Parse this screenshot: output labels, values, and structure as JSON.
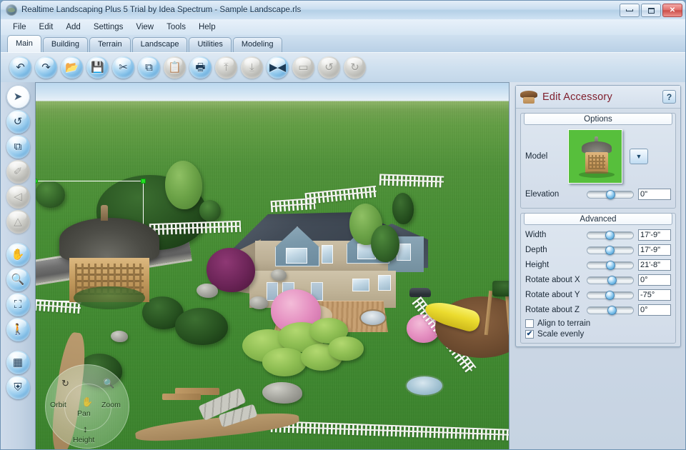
{
  "window": {
    "title": "Realtime Landscaping Plus 5 Trial by Idea Spectrum - Sample Landscape.rls",
    "app_icon": "app-globe-icon",
    "minimize_label": "Minimize",
    "maximize_label": "Maximize",
    "close_label": "✕"
  },
  "menubar": {
    "items": [
      {
        "label": "File"
      },
      {
        "label": "Edit"
      },
      {
        "label": "Add"
      },
      {
        "label": "Settings"
      },
      {
        "label": "View"
      },
      {
        "label": "Tools"
      },
      {
        "label": "Help"
      }
    ]
  },
  "tabs": {
    "active": "Main",
    "items": [
      {
        "label": "Main"
      },
      {
        "label": "Building"
      },
      {
        "label": "Terrain"
      },
      {
        "label": "Landscape"
      },
      {
        "label": "Utilities"
      },
      {
        "label": "Modeling"
      }
    ]
  },
  "toolbar": {
    "buttons": [
      {
        "name": "undo-icon",
        "glyph": "↶",
        "enabled": true
      },
      {
        "name": "redo-icon",
        "glyph": "↷",
        "enabled": true
      },
      {
        "name": "open-folder-icon",
        "glyph": "📂",
        "enabled": true
      },
      {
        "name": "save-icon",
        "glyph": "💾",
        "enabled": true
      },
      {
        "name": "cut-scissors-icon",
        "glyph": "✂",
        "enabled": true
      },
      {
        "name": "copy-icon",
        "glyph": "⧉",
        "enabled": true
      },
      {
        "name": "paste-icon",
        "glyph": "📋",
        "enabled": false
      },
      {
        "name": "print-icon",
        "glyph": "🖶",
        "enabled": true
      },
      {
        "name": "bring-to-front-icon",
        "glyph": "⤒",
        "enabled": false
      },
      {
        "name": "send-to-back-icon",
        "glyph": "⤓",
        "enabled": false
      },
      {
        "name": "mirror-icon",
        "glyph": "▶◀",
        "enabled": true
      },
      {
        "name": "flatten-icon",
        "glyph": "▭",
        "enabled": false
      },
      {
        "name": "rotate-left-icon",
        "glyph": "↺",
        "enabled": false
      },
      {
        "name": "rotate-right-icon",
        "glyph": "↻",
        "enabled": false
      }
    ]
  },
  "left_toolbar": {
    "buttons": [
      {
        "name": "select-arrow-tool",
        "glyph": "➤",
        "state": "active"
      },
      {
        "name": "rotate-tool",
        "glyph": "↺",
        "state": "normal"
      },
      {
        "name": "copy-place-tool",
        "glyph": "⧉",
        "state": "normal"
      },
      {
        "name": "freehand-region-tool",
        "glyph": "✐",
        "state": "disabled"
      },
      {
        "name": "polygon-region-tool",
        "glyph": "◁",
        "state": "disabled"
      },
      {
        "name": "shape-region-tool",
        "glyph": "△",
        "state": "disabled"
      },
      {
        "name": "pan-hand-tool",
        "glyph": "✋",
        "state": "normal"
      },
      {
        "name": "zoom-tool",
        "glyph": "🔍",
        "state": "normal"
      },
      {
        "name": "zoom-to-fit-tool",
        "glyph": "⛶",
        "state": "normal"
      },
      {
        "name": "walk-through-tool",
        "glyph": "🚶",
        "state": "normal"
      },
      {
        "name": "grid-tool",
        "glyph": "▦",
        "state": "normal"
      },
      {
        "name": "snap-magnet-tool",
        "glyph": "⛨",
        "state": "normal"
      }
    ]
  },
  "viewport": {
    "nav_compass": {
      "orbit_label": "Orbit",
      "pan_label": "Pan",
      "zoom_label": "Zoom",
      "height_label": "Height",
      "orbit_icon": "orbit-icon",
      "pan_icon": "hand-icon",
      "zoom_icon": "magnifier-icon",
      "height_icon": "updown-arrow-icon"
    },
    "selection": {
      "name": "gazebo-selection-box",
      "handle_round": "rotate-handle",
      "handle_square": "resize-handle"
    }
  },
  "panel": {
    "title": "Edit Accessory",
    "icon": "gazebo-icon",
    "help_label": "?",
    "groups": {
      "options": {
        "title": "Options",
        "model_label": "Model",
        "model_thumb": "gazebo-thumbnail",
        "dropdown_icon": "chevron-down-icon",
        "elevation_label": "Elevation",
        "elevation_value": "0\"",
        "elevation_slider_pct": 41
      },
      "advanced": {
        "title": "Advanced",
        "rows": [
          {
            "label": "Width",
            "value": "17'-9\"",
            "slider_pct": 40
          },
          {
            "label": "Depth",
            "value": "17'-9\"",
            "slider_pct": 40
          },
          {
            "label": "Height",
            "value": "21'-8\"",
            "slider_pct": 41
          },
          {
            "label": "Rotate about X",
            "value": "0°",
            "slider_pct": 44
          },
          {
            "label": "Rotate about Y",
            "value": "-75°",
            "slider_pct": 40
          },
          {
            "label": "Rotate about Z",
            "value": "0°",
            "slider_pct": 44
          }
        ],
        "checkboxes": [
          {
            "label": "Align to terrain",
            "checked": false,
            "name": "align-to-terrain-checkbox"
          },
          {
            "label": "Scale evenly",
            "checked": true,
            "name": "scale-evenly-checkbox",
            "mark": "✔"
          }
        ]
      }
    }
  },
  "colors": {
    "title_text": "#17324d",
    "panel_title": "#7f1d2b",
    "accent_blue": "#4f99d0",
    "selection_handle": "#22dd22",
    "lawn": "#479033",
    "sky": "#b9d7ee"
  }
}
